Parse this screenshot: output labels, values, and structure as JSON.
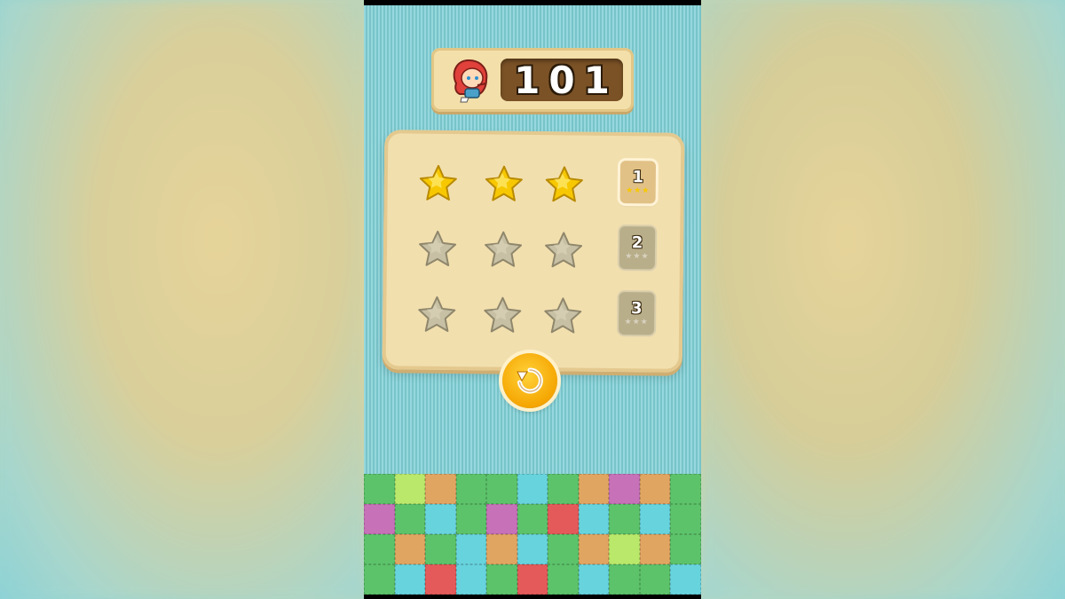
{
  "score": {
    "value": "101"
  },
  "levels": [
    {
      "number": "1",
      "earned_stars": 3,
      "max_stars": 3,
      "status": "unlocked"
    },
    {
      "number": "2",
      "earned_stars": 0,
      "max_stars": 3,
      "status": "locked"
    },
    {
      "number": "3",
      "earned_stars": 0,
      "max_stars": 3,
      "status": "locked"
    }
  ],
  "mini_star_glyphs": "★★★",
  "colors": {
    "star_gold": "#f7c800",
    "star_grey": "#c7c0a4",
    "panel": "#f2dfae",
    "background_teal": "#7fd0d6",
    "replay_orange": "#f5a500"
  },
  "icons": {
    "replay": "replay-icon",
    "avatar": "red-haired-girl-avatar",
    "star": "star-icon"
  },
  "tile_colors": [
    "#5cc36a",
    "#b9e86a",
    "#e1a562",
    "#5cc36a",
    "#5cc36a",
    "#67d3dd",
    "#5cc36a",
    "#e1a562",
    "#c771b8",
    "#e1a562",
    "#5cc36a",
    "#c771b8",
    "#5cc36a",
    "#67d3dd",
    "#5cc36a",
    "#c771b8",
    "#5cc36a",
    "#e45a5a",
    "#67d3dd",
    "#5cc36a",
    "#67d3dd",
    "#5cc36a",
    "#5cc36a",
    "#e1a562",
    "#5cc36a",
    "#67d3dd",
    "#e1a562",
    "#67d3dd",
    "#5cc36a",
    "#e1a562",
    "#b9e86a",
    "#e1a562",
    "#5cc36a",
    "#5cc36a",
    "#67d3dd",
    "#e45a5a",
    "#67d3dd",
    "#5cc36a",
    "#e45a5a",
    "#5cc36a",
    "#67d3dd",
    "#5cc36a",
    "#5cc36a",
    "#67d3dd"
  ]
}
